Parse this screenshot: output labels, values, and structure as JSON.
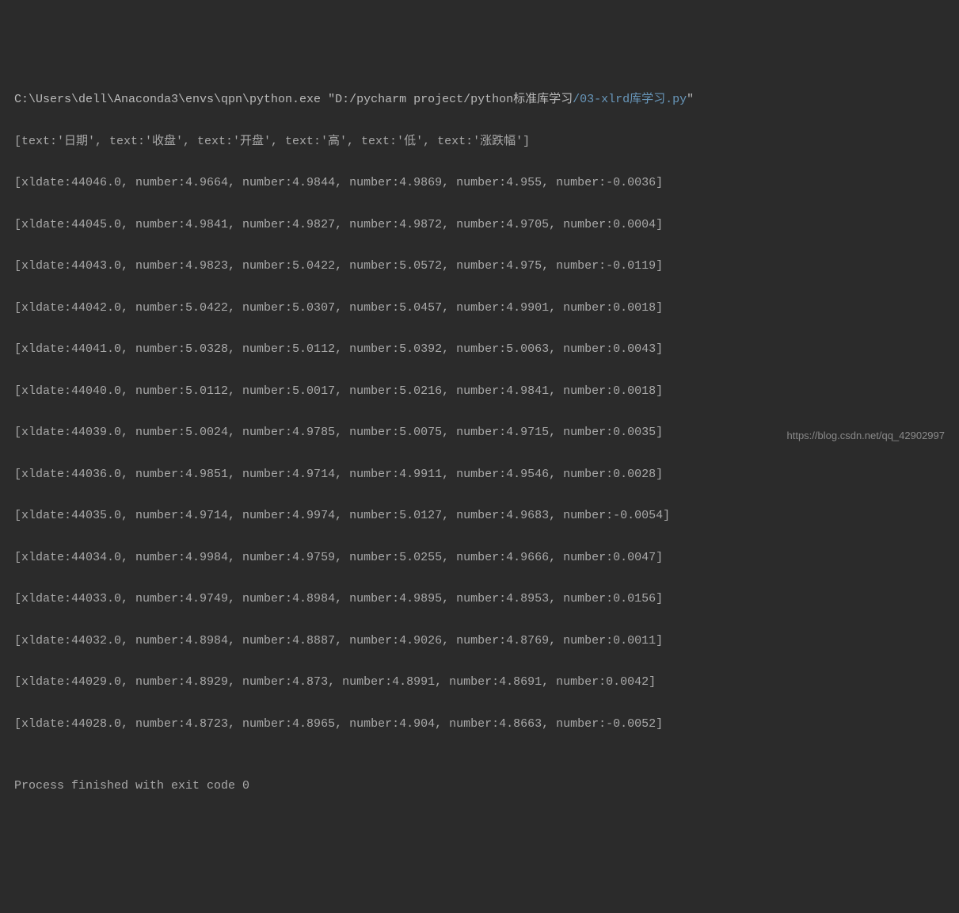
{
  "command": {
    "interpreter": "C:\\Users\\dell\\Anaconda3\\envs\\qpn\\python.exe",
    "arg_prefix": "\"D:/pycharm project/python标准库学习",
    "script_file": "/03-xlrd库学习.py",
    "arg_suffix": "\""
  },
  "header_row": "[text:'日期', text:'收盘', text:'开盘', text:'高', text:'低', text:'涨跌幅']",
  "rows": [
    "[xldate:44046.0, number:4.9664, number:4.9844, number:4.9869, number:4.955, number:-0.0036]",
    "[xldate:44045.0, number:4.9841, number:4.9827, number:4.9872, number:4.9705, number:0.0004]",
    "[xldate:44043.0, number:4.9823, number:5.0422, number:5.0572, number:4.975, number:-0.0119]",
    "[xldate:44042.0, number:5.0422, number:5.0307, number:5.0457, number:4.9901, number:0.0018]",
    "[xldate:44041.0, number:5.0328, number:5.0112, number:5.0392, number:5.0063, number:0.0043]",
    "[xldate:44040.0, number:5.0112, number:5.0017, number:5.0216, number:4.9841, number:0.0018]",
    "[xldate:44039.0, number:5.0024, number:4.9785, number:5.0075, number:4.9715, number:0.0035]",
    "[xldate:44036.0, number:4.9851, number:4.9714, number:4.9911, number:4.9546, number:0.0028]",
    "[xldate:44035.0, number:4.9714, number:4.9974, number:5.0127, number:4.9683, number:-0.0054]",
    "[xldate:44034.0, number:4.9984, number:4.9759, number:5.0255, number:4.9666, number:0.0047]",
    "[xldate:44033.0, number:4.9749, number:4.8984, number:4.9895, number:4.8953, number:0.0156]",
    "[xldate:44032.0, number:4.8984, number:4.8887, number:4.9026, number:4.8769, number:0.0011]",
    "[xldate:44029.0, number:4.8929, number:4.873, number:4.8991, number:4.8691, number:0.0042]",
    "[xldate:44028.0, number:4.8723, number:4.8965, number:4.904, number:4.8663, number:-0.0052]"
  ],
  "footer": "Process finished with exit code 0",
  "watermark": "https://blog.csdn.net/qq_42902997"
}
